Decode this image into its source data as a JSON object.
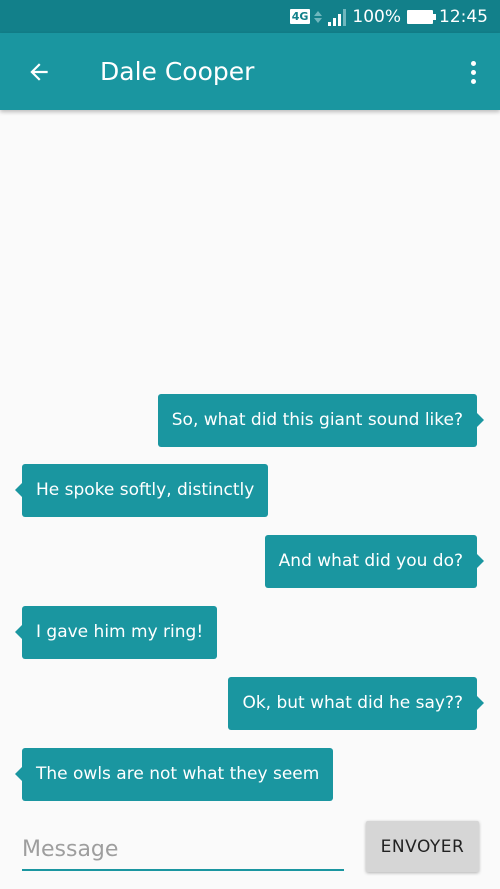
{
  "status_bar": {
    "network": "4G",
    "battery": "100%",
    "time": "12:45"
  },
  "app_bar": {
    "title": "Dale Cooper",
    "back_icon": "arrow-back-icon",
    "menu_icon": "more-vert-icon"
  },
  "messages": [
    {
      "direction": "out",
      "text": "So, what did this giant sound like?"
    },
    {
      "direction": "in",
      "text": "He spoke softly, distinctly"
    },
    {
      "direction": "out",
      "text": "And what did you do?"
    },
    {
      "direction": "in",
      "text": "I gave him my ring!"
    },
    {
      "direction": "out",
      "text": "Ok, but what did he say??"
    },
    {
      "direction": "in",
      "text": "The owls are not what they seem"
    }
  ],
  "composer": {
    "placeholder": "Message",
    "value": "",
    "send_label": "ENVOYER"
  },
  "colors": {
    "status_bar": "#12808a",
    "primary": "#1a96a0",
    "background": "#fafafa",
    "button": "#d6d6d6"
  }
}
